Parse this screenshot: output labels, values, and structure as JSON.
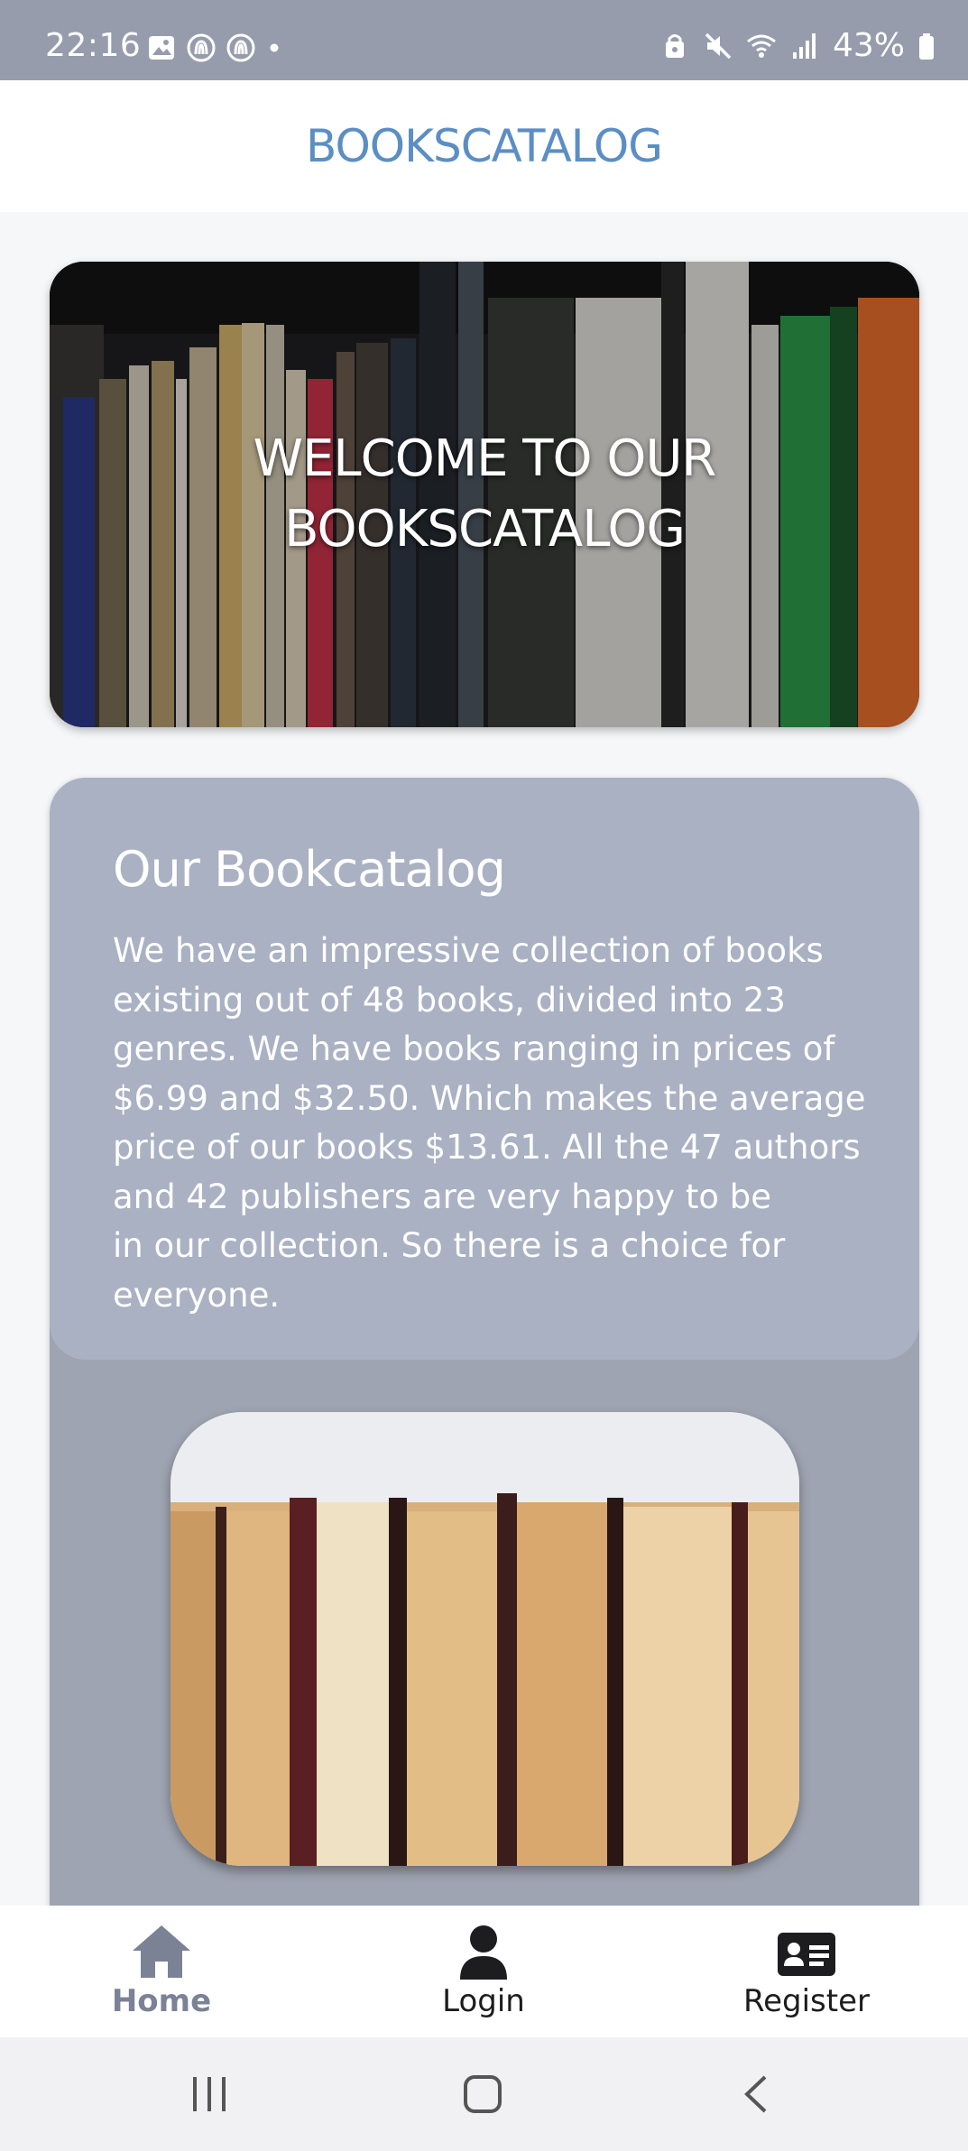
{
  "status_bar": {
    "time": "22:16",
    "battery": "43%",
    "icons_left": [
      "image-icon",
      "nfc-icon",
      "nfc-icon",
      "dot-icon"
    ],
    "icons_right": [
      "lock-icon",
      "mute-icon",
      "wifi-icon",
      "signal-icon",
      "battery-icon"
    ]
  },
  "header": {
    "title": "BOOKSCATALOG"
  },
  "hero": {
    "text": "WELCOME TO OUR\nBOOKSCATALOG"
  },
  "info": {
    "heading": "Our Bookcatalog",
    "body": "We have an impressive collection of books\nexisting out of 48 books, divided into 23\ngenres. We have books ranging in prices of\n$6.99 and $32.50. Which makes the average\nprice of our books $13.61. All the 47 authors\nand 42 publishers are very happy to be\nin our collection. So there is a choice for\neveryone."
  },
  "nav": {
    "home": "Home",
    "login": "Login",
    "register": "Register"
  },
  "colors": {
    "accent": "#5b8ec4",
    "card": "#a9b1c3",
    "nav_active": "#7b8296"
  }
}
